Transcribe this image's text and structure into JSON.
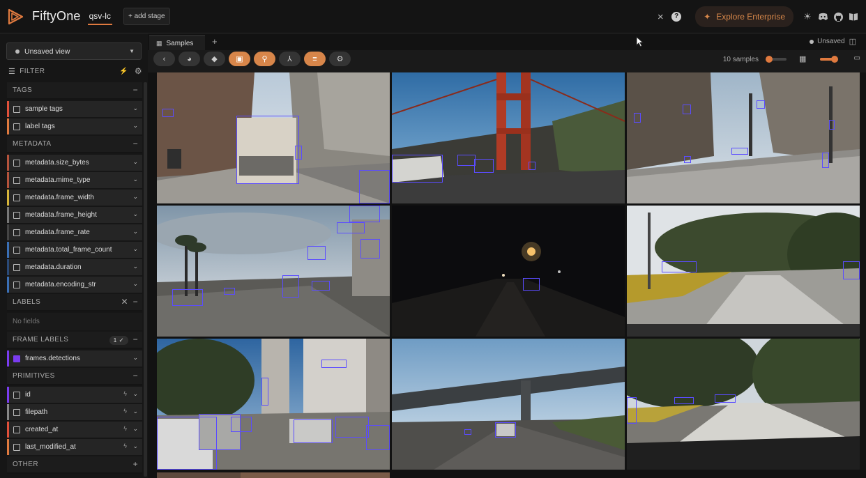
{
  "header": {
    "app_name": "FiftyOne",
    "dataset": "qsv-lc",
    "add_stage": "+ add stage",
    "close_icon": "×",
    "help_icon": "?",
    "explore": "Explore Enterprise",
    "icons": [
      "sun-icon",
      "discord-icon",
      "github-icon",
      "book-icon"
    ]
  },
  "sidebar": {
    "view_select": "Unsaved view",
    "filter_label": "FILTER",
    "sections": {
      "tags": "TAGS",
      "metadata": "METADATA",
      "labels": "LABELS",
      "frame_labels": "FRAME LABELS",
      "primitives": "PRIMITIVES",
      "other": "OTHER"
    },
    "tags": [
      {
        "label": "sample tags",
        "color": "#e0503a"
      },
      {
        "label": "label tags",
        "color": "#e07a3f"
      }
    ],
    "metadata": [
      {
        "label": "metadata.size_bytes",
        "color": "#b5533c"
      },
      {
        "label": "metadata.mime_type",
        "color": "#b5533c"
      },
      {
        "label": "metadata.frame_width",
        "color": "#d6b53a"
      },
      {
        "label": "metadata.frame_height",
        "color": "#777777"
      },
      {
        "label": "metadata.frame_rate",
        "color": "#444444"
      },
      {
        "label": "metadata.total_frame_count",
        "color": "#3a6fb5"
      },
      {
        "label": "metadata.duration",
        "color": "#2a4a78"
      },
      {
        "label": "metadata.encoding_str",
        "color": "#3a6fb5"
      }
    ],
    "labels_empty": "No fields",
    "frame_labels_count": "1 ✓",
    "frame_labels": [
      {
        "label": "frames.detections",
        "color": "#7a3cf0"
      }
    ],
    "primitives": [
      {
        "label": "id",
        "color": "#7a3cf0"
      },
      {
        "label": "filepath",
        "color": "#888888"
      },
      {
        "label": "created_at",
        "color": "#e0503a"
      },
      {
        "label": "last_modified_at",
        "color": "#e07a3f"
      }
    ]
  },
  "main": {
    "tab_label": "Samples",
    "tab_add": "+",
    "unsaved": "Unsaved",
    "samples_count": "10 samples",
    "accent": "#e07a3f"
  }
}
